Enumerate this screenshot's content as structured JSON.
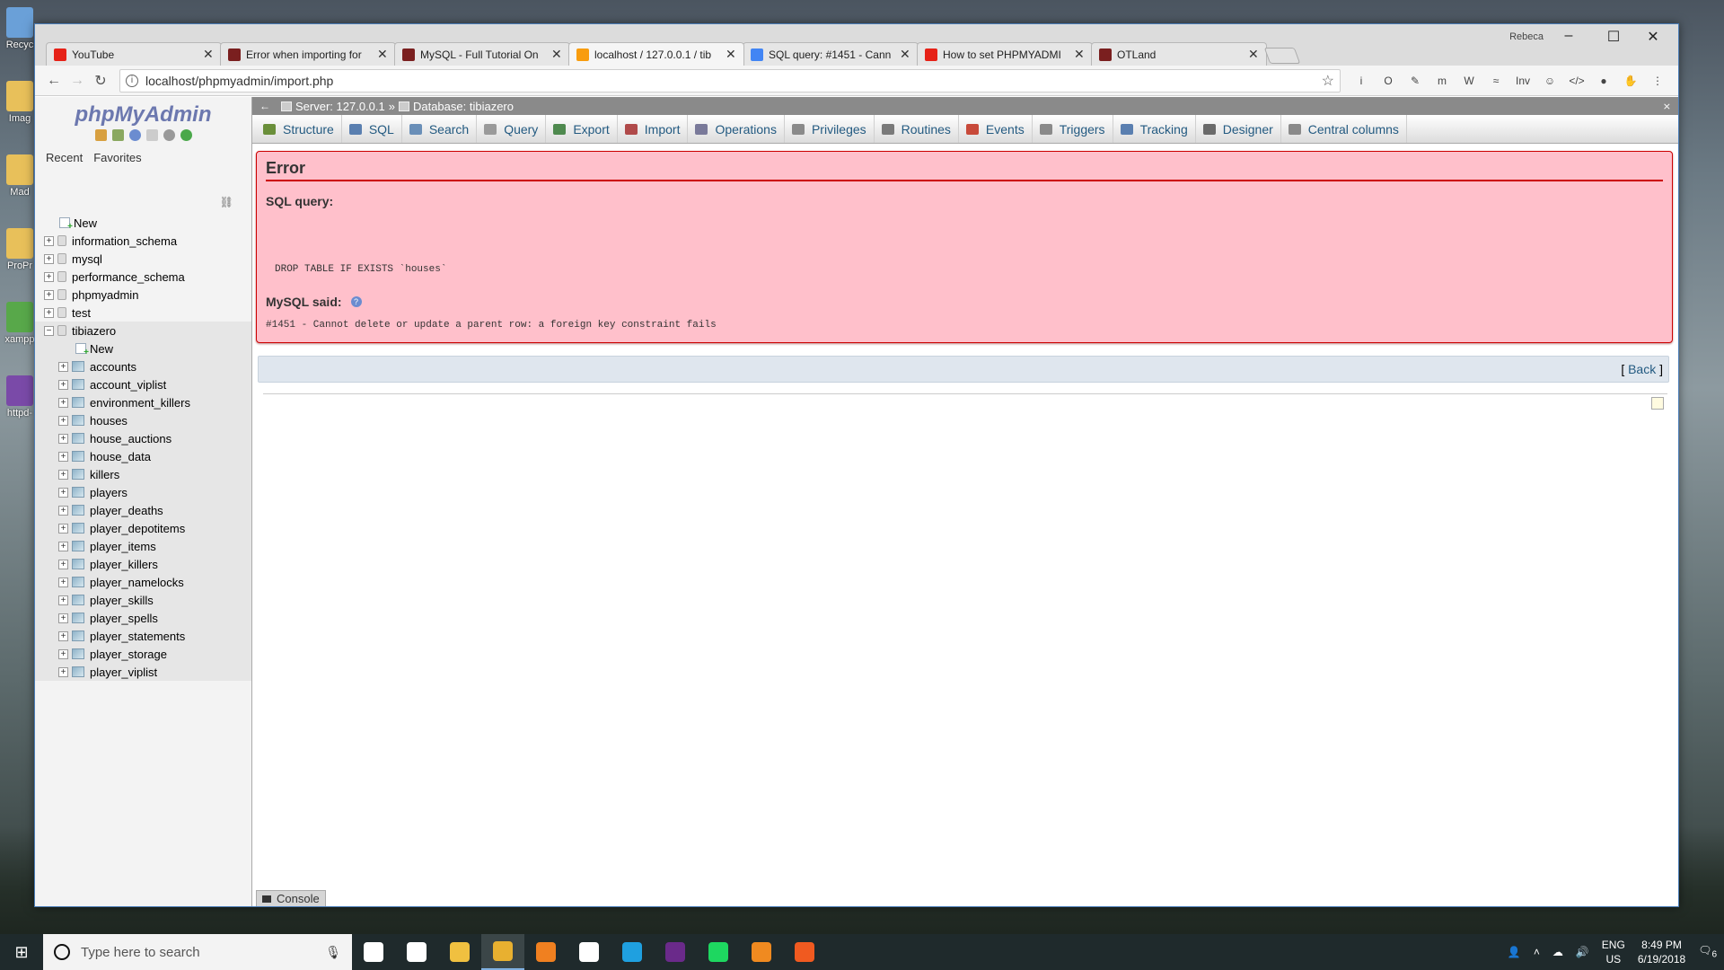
{
  "desktop": {
    "icons": [
      {
        "label": "Recyc",
        "color": "#6aa0d8"
      },
      {
        "label": "Imag",
        "color": "#e8c05a"
      },
      {
        "label": "Mad",
        "color": "#e8c05a"
      },
      {
        "label": "ProPr",
        "color": "#e8c05a"
      },
      {
        "label": "xampp",
        "color": "#58a84a"
      },
      {
        "label": "httpd-",
        "color": "#7a4aa8"
      }
    ]
  },
  "browser": {
    "user": "Rebeca",
    "tabs": [
      {
        "title": "YouTube",
        "icon_color": "#e62117"
      },
      {
        "title": "Error when importing for",
        "icon_color": "#7a1f1f"
      },
      {
        "title": "MySQL - Full Tutorial On",
        "icon_color": "#7a1f1f"
      },
      {
        "title": "localhost / 127.0.0.1 / tib",
        "icon_color": "#f89c0e"
      },
      {
        "title": "SQL query: #1451 - Cann",
        "icon_color": "#4285f4"
      },
      {
        "title": "How to set PHPMYADMI",
        "icon_color": "#e62117"
      },
      {
        "title": "OTLand",
        "icon_color": "#7a1f1f"
      }
    ],
    "active_tab": 3,
    "url": "localhost/phpmyadmin/import.php",
    "extensions": [
      "i",
      "O",
      "✎",
      "m",
      "W",
      "≈",
      "Inv",
      "☺",
      "</>",
      "●",
      "✋",
      "⋮"
    ]
  },
  "sidebar": {
    "logo_php": "php",
    "logo_my": "MyAdmin",
    "recent_label": "Recent",
    "favorites_label": "Favorites",
    "new_label": "New",
    "databases": [
      "information_schema",
      "mysql",
      "performance_schema",
      "phpmyadmin",
      "test"
    ],
    "expanded_db": "tibiazero",
    "tables": [
      "accounts",
      "account_viplist",
      "environment_killers",
      "houses",
      "house_auctions",
      "house_data",
      "killers",
      "players",
      "player_deaths",
      "player_depotitems",
      "player_items",
      "player_killers",
      "player_namelocks",
      "player_skills",
      "player_spells",
      "player_statements",
      "player_storage",
      "player_viplist"
    ]
  },
  "breadcrumb": {
    "server": "Server: 127.0.0.1",
    "sep": "»",
    "database": "Database: tibiazero"
  },
  "menu": [
    {
      "label": "Structure",
      "color": "#6a8f3a"
    },
    {
      "label": "SQL",
      "color": "#5a7fb0"
    },
    {
      "label": "Search",
      "color": "#6a8fb8"
    },
    {
      "label": "Query",
      "color": "#9a9a9a"
    },
    {
      "label": "Export",
      "color": "#4f8a4f"
    },
    {
      "label": "Import",
      "color": "#b04a4a"
    },
    {
      "label": "Operations",
      "color": "#7a7a9a"
    },
    {
      "label": "Privileges",
      "color": "#8a8a8a"
    },
    {
      "label": "Routines",
      "color": "#7a7a7a"
    },
    {
      "label": "Events",
      "color": "#c84a3a"
    },
    {
      "label": "Triggers",
      "color": "#8a8a8a"
    },
    {
      "label": "Tracking",
      "color": "#5a7fb0"
    },
    {
      "label": "Designer",
      "color": "#6a6a6a"
    },
    {
      "label": "Central columns",
      "color": "#8a8a8a"
    }
  ],
  "error": {
    "title": "Error",
    "sql_query_label": "SQL query:",
    "sql_query": "DROP TABLE IF EXISTS `houses`",
    "mysql_said_label": "MySQL said:",
    "message": "#1451 - Cannot delete or update a parent row: a foreign key constraint fails"
  },
  "back_link": "Back",
  "console_label": "Console",
  "taskbar": {
    "search_placeholder": "Type here to search",
    "apps": [
      {
        "name": "task-view",
        "color": "#ffffff"
      },
      {
        "name": "store",
        "color": "#ffffff"
      },
      {
        "name": "file-explorer",
        "color": "#f0c040"
      },
      {
        "name": "chrome",
        "color": "#e8b030"
      },
      {
        "name": "firefox",
        "color": "#f08020"
      },
      {
        "name": "slack",
        "color": "#ffffff"
      },
      {
        "name": "skype",
        "color": "#1fa0e0"
      },
      {
        "name": "premiere",
        "color": "#6a2a8a"
      },
      {
        "name": "spotify",
        "color": "#1ed760"
      },
      {
        "name": "sublime",
        "color": "#f08a20"
      },
      {
        "name": "xampp",
        "color": "#f05a20"
      }
    ],
    "active_app": 3,
    "lang": "ENG",
    "region": "US",
    "time": "8:49 PM",
    "date": "6/19/2018",
    "notification_count": "6"
  }
}
